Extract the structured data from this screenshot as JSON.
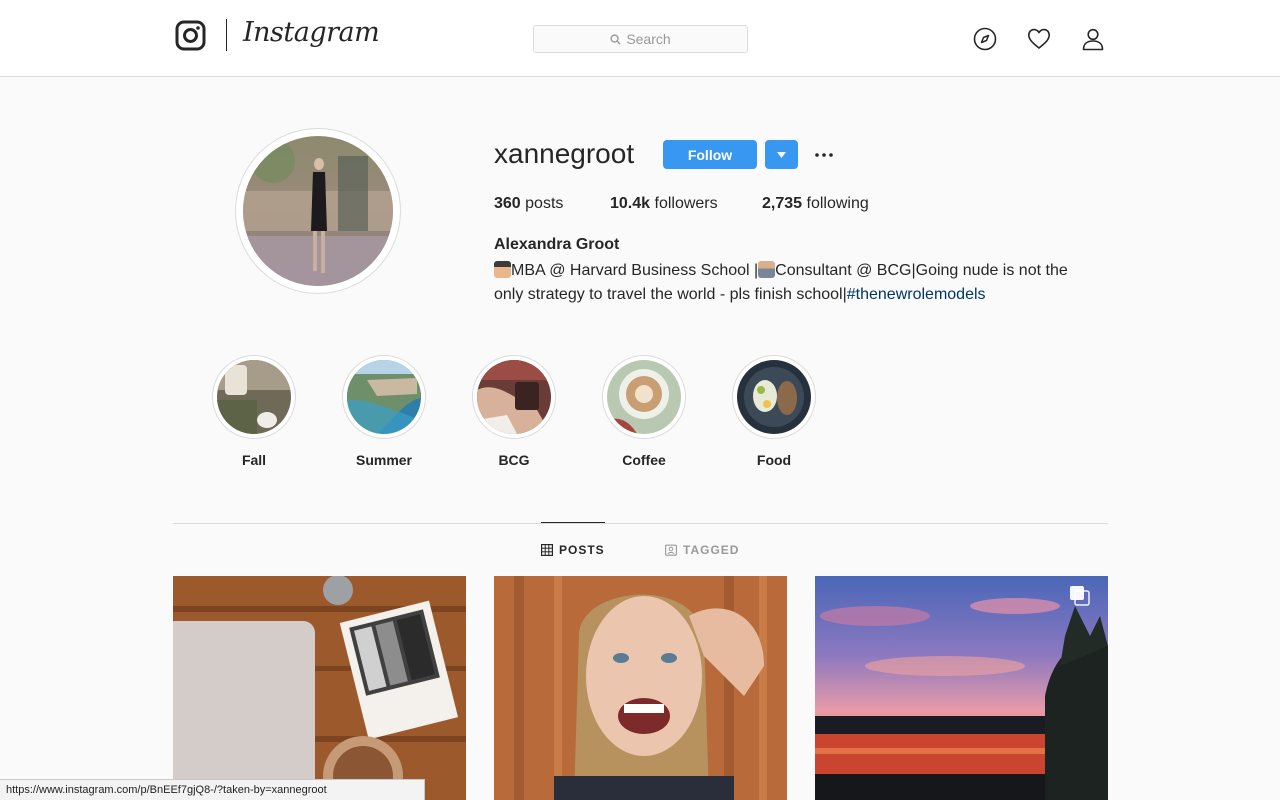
{
  "header": {
    "logo_text": "Instagram",
    "search_placeholder": "Search",
    "icons": [
      "instagram-glyph-icon",
      "compass-icon",
      "heart-icon",
      "person-icon"
    ]
  },
  "profile": {
    "username": "xannegroot",
    "follow_label": "Follow",
    "stats": {
      "posts_count": "360",
      "posts_label": "posts",
      "followers_count": "10.4k",
      "followers_label": "followers",
      "following_count": "2,735",
      "following_label": "following"
    },
    "full_name": "Alexandra Groot",
    "bio_part1": "MBA @ Harvard Business School |",
    "bio_part2": "Consultant @ BCG|Going nude is not the only strategy to travel the world - pls finish school|",
    "bio_hashtag": "#thenewrolemodels"
  },
  "highlights": [
    {
      "label": "Fall"
    },
    {
      "label": "Summer"
    },
    {
      "label": "BCG"
    },
    {
      "label": "Coffee"
    },
    {
      "label": "Food"
    }
  ],
  "tabs": {
    "posts_label": "POSTS",
    "tagged_label": "TAGGED",
    "active": "POSTS"
  },
  "status_url": "https://www.instagram.com/p/BnEEf7gjQ8-/?taken-by=xannegroot",
  "colors": {
    "accent_blue": "#3897f0",
    "hashtag": "#003569",
    "text": "#262626",
    "border": "#dbdbdb",
    "background": "#fafafa"
  }
}
